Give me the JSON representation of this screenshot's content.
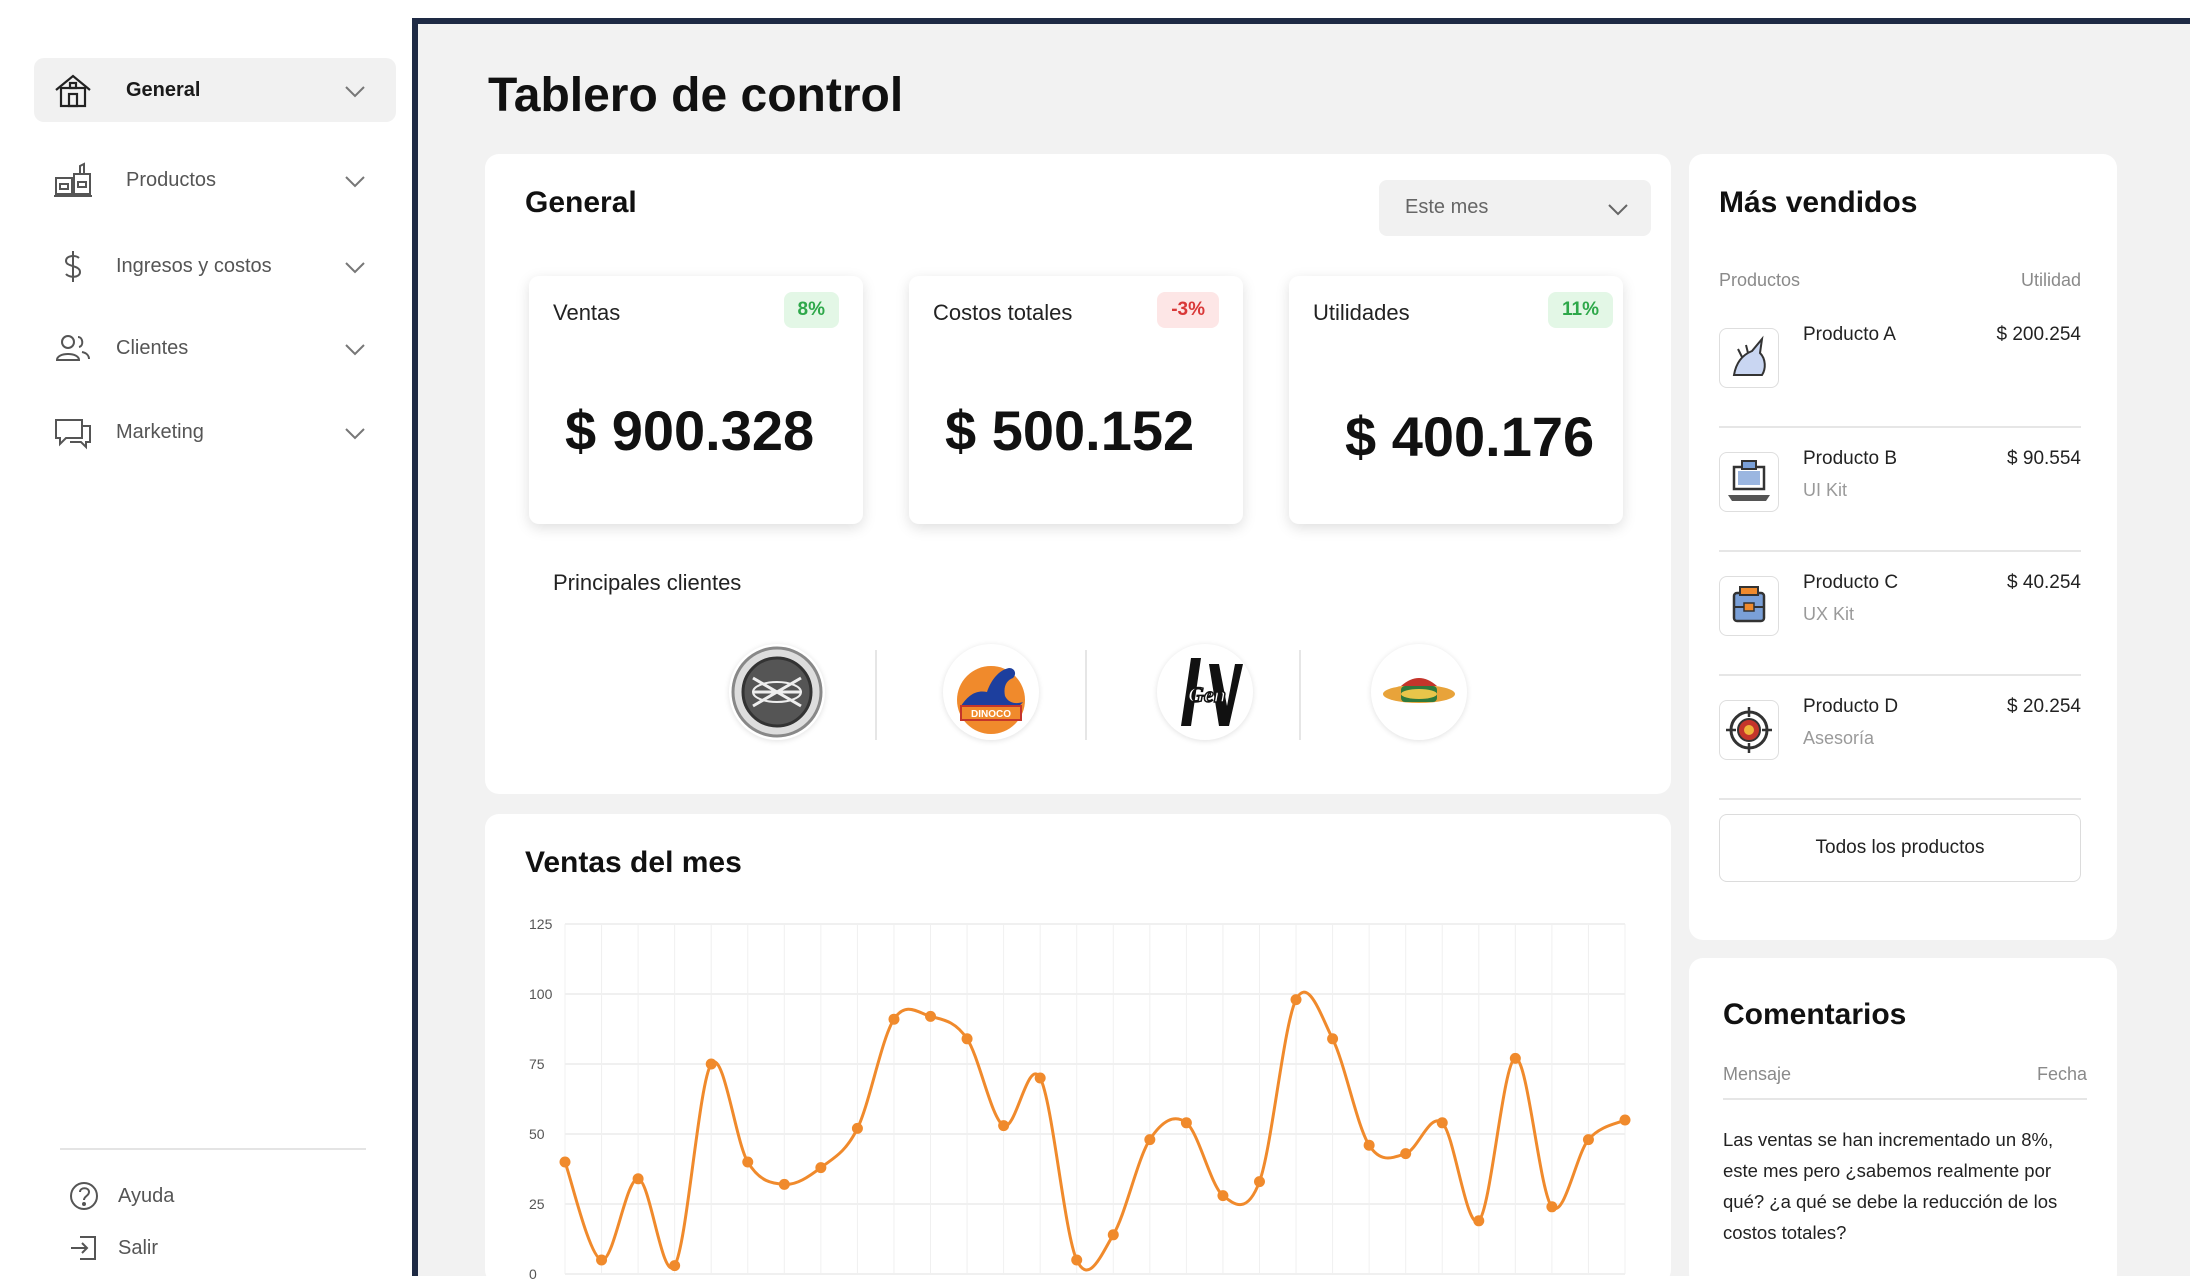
{
  "sidebar": {
    "items": [
      {
        "label": "General",
        "icon": "home-icon",
        "active": true
      },
      {
        "label": "Productos",
        "icon": "factory-icon",
        "active": false
      },
      {
        "label": "Ingresos y costos",
        "icon": "dollar-icon",
        "active": false
      },
      {
        "label": "Clientes",
        "icon": "users-icon",
        "active": false
      },
      {
        "label": "Marketing",
        "icon": "chat-icon",
        "active": false
      }
    ],
    "footer": [
      {
        "label": "Ayuda",
        "icon": "help-icon"
      },
      {
        "label": "Salir",
        "icon": "logout-icon"
      }
    ]
  },
  "page": {
    "title": "Tablero de control"
  },
  "general": {
    "title": "General",
    "period": "Este mes",
    "kpis": [
      {
        "label": "Ventas",
        "badge": "8%",
        "value": "$ 900.328",
        "trend": "up"
      },
      {
        "label": "Costos totales",
        "badge": "-3%",
        "value": "$ 500.152",
        "trend": "down"
      },
      {
        "label": "Utilidades",
        "badge": "11%",
        "value": "$ 400.176",
        "trend": "up"
      }
    ],
    "clients_label": "Principales clientes",
    "clients": [
      "x-mesh-logo",
      "dinoco-logo",
      "ingen-logo",
      "central-perk-logo"
    ]
  },
  "sales": {
    "title": "Ventas del mes",
    "chart_data": {
      "type": "line",
      "title": "Ventas del mes",
      "xlabel": "",
      "ylabel": "",
      "ylim": [
        0,
        125
      ],
      "yticks": [
        "0",
        "25",
        "50",
        "75",
        "100",
        "125"
      ],
      "grid": true,
      "legend": "none",
      "color": "#f08a2c",
      "x": [
        1,
        2,
        3,
        4,
        5,
        6,
        7,
        8,
        9,
        10,
        11,
        12,
        13,
        14,
        15,
        16,
        17,
        18,
        19,
        20,
        21,
        22,
        23,
        24,
        25,
        26,
        27,
        28,
        29,
        30
      ],
      "values": [
        40,
        5,
        34,
        3,
        75,
        40,
        32,
        38,
        52,
        91,
        92,
        84,
        53,
        70,
        5,
        14,
        48,
        54,
        28,
        33,
        98,
        84,
        46,
        43,
        54,
        19,
        77,
        24,
        48,
        55
      ]
    }
  },
  "bestsellers": {
    "title": "Más vendidos",
    "col_product": "Productos",
    "col_profit": "Utilidad",
    "items": [
      {
        "name": "Producto A",
        "sub": "",
        "price": "$ 200.254",
        "icon": "unicorn-icon"
      },
      {
        "name": "Producto B",
        "sub": "UI Kit",
        "price": "$ 90.554",
        "icon": "laptop-kit-icon"
      },
      {
        "name": "Producto C",
        "sub": "UX Kit",
        "price": "$ 40.254",
        "icon": "toolbox-icon"
      },
      {
        "name": "Producto D",
        "sub": "Asesoría",
        "price": "$ 20.254",
        "icon": "target-icon"
      }
    ],
    "button": "Todos los productos"
  },
  "comments": {
    "title": "Comentarios",
    "col_message": "Mensaje",
    "col_date": "Fecha",
    "message": "Las ventas se han incrementado un 8%, este mes pero ¿sabemos realmente por qué? ¿a qué se debe la reducción de los costos totales?"
  },
  "colors": {
    "accent": "#f08a2c",
    "positive": "#2ea84a",
    "negative": "#d93838",
    "frame": "#1e2a44"
  }
}
